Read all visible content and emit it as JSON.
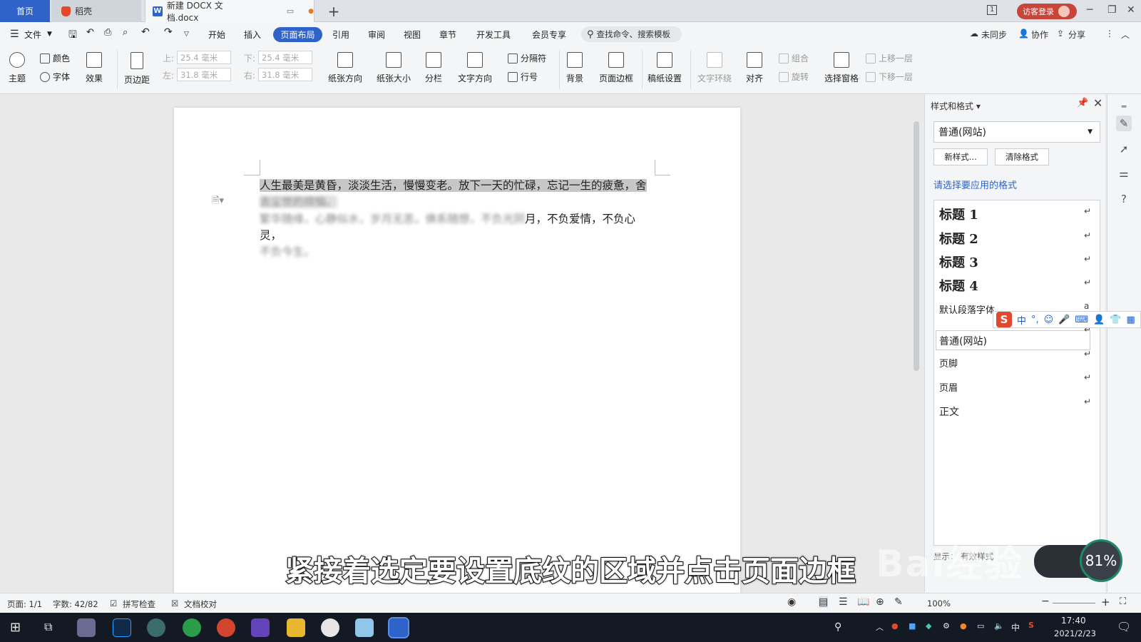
{
  "tabs": {
    "home": "首页",
    "daoke": "稻壳",
    "document": "新建 DOCX 文档.docx",
    "new_tab": "+"
  },
  "window": {
    "login": "访客登录",
    "minimize": "─",
    "restore": "❐",
    "close": "✕",
    "tile": "1"
  },
  "menu": {
    "file": "文件",
    "items": [
      "开始",
      "插入",
      "页面布局",
      "引用",
      "审阅",
      "视图",
      "章节",
      "开发工具",
      "会员专享"
    ],
    "active_index": 2,
    "search": "查找命令、搜索模板",
    "right": [
      "未同步",
      "协作",
      "分享"
    ]
  },
  "ribbon": {
    "theme": "主题",
    "color": "颜色",
    "font": "字体",
    "effect": "效果",
    "margin": "页边距",
    "top_label": "上:",
    "top_value": "25.4 毫米",
    "bottom_label": "下:",
    "bottom_value": "25.4 毫米",
    "left_label": "左:",
    "left_value": "31.8 毫米",
    "right_label": "右:",
    "right_value": "31.8 毫米",
    "orientation": "纸张方向",
    "size": "纸张大小",
    "columns": "分栏",
    "text_direction": "文字方向",
    "separator": "分隔符",
    "line_number": "行号",
    "background": "背景",
    "page_border": "页面边框",
    "draft_settings": "稿纸设置",
    "text_wrap": "文字环绕",
    "align": "对齐",
    "group": "组合",
    "rotate": "旋转",
    "selection_pane": "选择窗格",
    "bring_forward": "上移一层",
    "send_backward": "下移一层"
  },
  "document": {
    "para1_selected": "人生最美是黄昏，淡淡生活，慢慢变老。放下一天的忙碌，忘记一生的疲惫，舍",
    "para1_selected_2": "去尘世的烦恼。",
    "para2_visible": "月，不负爱情，不负心灵，",
    "para2_blurred": "繁华随缘，心静似水，岁月无恙，佛系随想，不负光阴",
    "para3_blurred": "不负今生。"
  },
  "styles_panel": {
    "title": "样式和格式",
    "current_style": "普通(网站)",
    "new_style": "新样式...",
    "clear_format": "清除格式",
    "hint": "请选择要应用的格式",
    "items": [
      "标题 1",
      "标题 2",
      "标题 3",
      "标题 4",
      "默认段落字体",
      "普通(网站)",
      "页脚",
      "页眉",
      "正文"
    ],
    "footer": "显示：   有效样式"
  },
  "status": {
    "page": "页面: 1/1",
    "words": "字数: 42/82",
    "spell": "拼写检查",
    "proof": "文档校对",
    "zoom": "100%"
  },
  "taskbar": {
    "time": "17:40",
    "date": "2021/2/23",
    "ime": "中"
  },
  "overlay": {
    "subtitle": "紧接着选定要设置底纹的区域并点击页面边框",
    "progress": "81%",
    "watermark": "Bai经验"
  },
  "colors": {
    "accent": "#2f63c9",
    "login": "#c8453a",
    "taskbar": "#141a24"
  }
}
